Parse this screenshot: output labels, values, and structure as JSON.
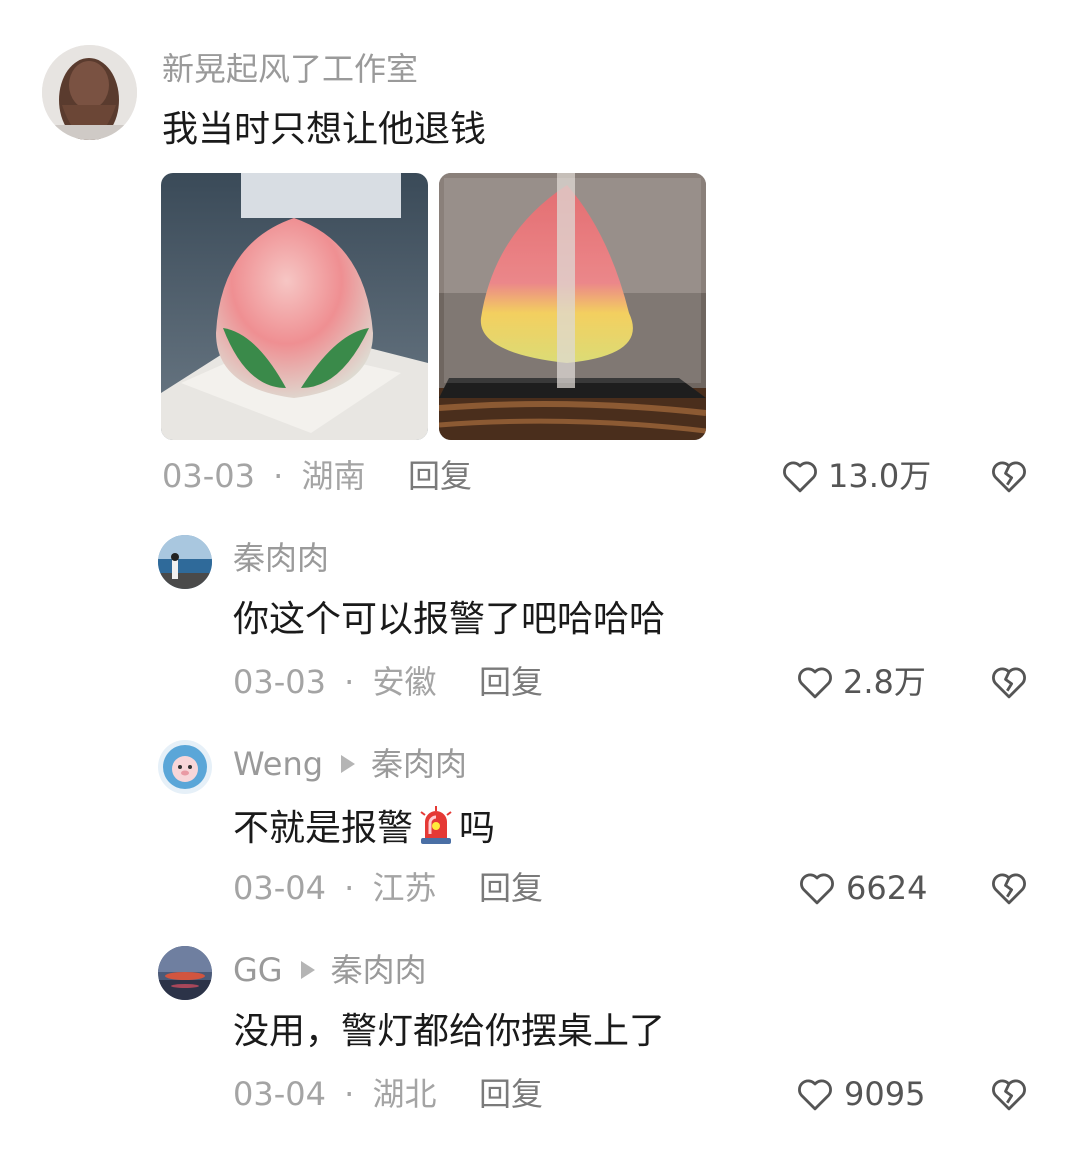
{
  "comments": [
    {
      "username": "新晃起风了工作室",
      "text": "我当时只想让他退钱",
      "date": "03-03",
      "location": "湖南",
      "reply_label": "回复",
      "likes": "13.0万"
    },
    {
      "username": "秦肉肉",
      "text": "你这个可以报警了吧哈哈哈",
      "date": "03-03",
      "location": "安徽",
      "reply_label": "回复",
      "likes": "2.8万"
    },
    {
      "username": "Weng",
      "reply_to": "秦肉肉",
      "text_before": "不就是报警",
      "text_after": "吗",
      "date": "03-04",
      "location": "江苏",
      "reply_label": "回复",
      "likes": "6624"
    },
    {
      "username": "GG",
      "reply_to": "秦肉肉",
      "text": "没用，警灯都给你摆桌上了",
      "date": "03-04",
      "location": "湖北",
      "reply_label": "回复",
      "likes": "9095"
    }
  ],
  "separator": "·",
  "icons": {
    "like": "heart-icon",
    "dislike": "broken-heart-icon",
    "reply_arrow": "triangle-right-icon",
    "siren": "police-light-emoji"
  }
}
